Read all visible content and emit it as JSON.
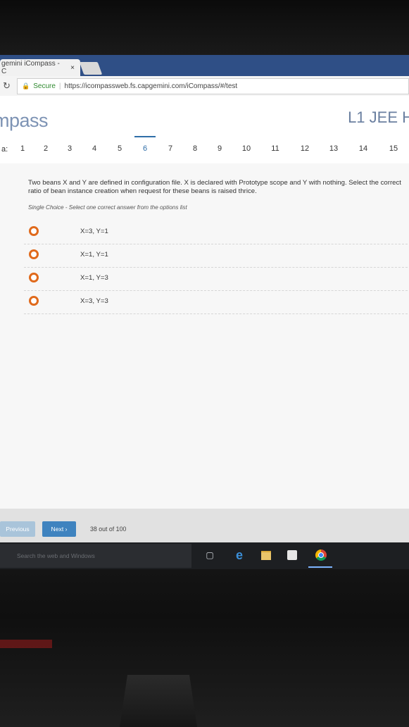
{
  "browser": {
    "tab_title": "gemini iCompass - C",
    "tab_close": "×",
    "secure_label": "Secure",
    "url": "https://icompassweb.fs.capgemini.com/iCompass/#/test"
  },
  "header": {
    "logo": "mpass",
    "test_title": "L1 JEE H"
  },
  "question_nav": {
    "lead": "a:",
    "numbers": [
      "1",
      "2",
      "3",
      "4",
      "5",
      "6",
      "7",
      "8",
      "9",
      "10",
      "11",
      "12",
      "13",
      "14",
      "15"
    ],
    "active": "6"
  },
  "question": {
    "text": "Two beans X and Y are defined in configuration file. X is declared with Prototype scope and Y with nothing. Select the correct ratio of bean instance creation when request for these beans is raised thrice.",
    "hint": "Single Choice - Select one correct answer from the options list",
    "options": [
      "X=3, Y=1",
      "X=1, Y=1",
      "X=1, Y=3",
      "X=3, Y=3"
    ]
  },
  "footer": {
    "previous_label": "Previous",
    "next_label": "Next ›",
    "progress": "38 out of 100"
  },
  "taskbar": {
    "search_placeholder": "Search the web and Windows"
  },
  "colors": {
    "accent": "#2f6ea8",
    "radio": "#e06a1c",
    "next_button": "#3f83bf"
  }
}
